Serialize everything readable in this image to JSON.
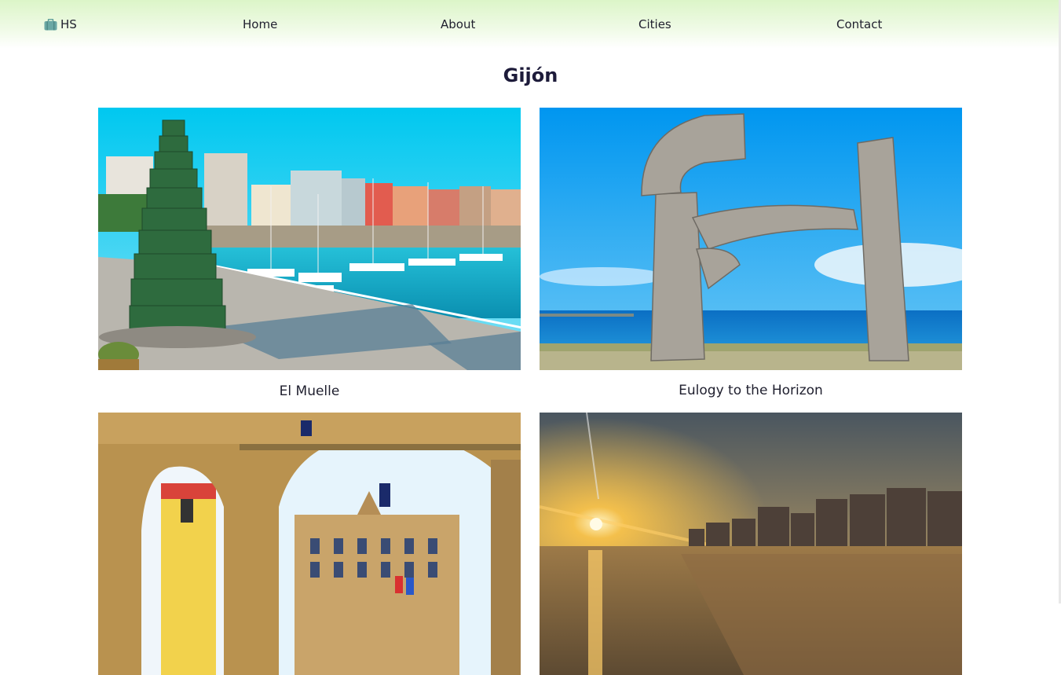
{
  "nav": {
    "brand": "HS",
    "brand_icon": "suitcase-icon",
    "links": [
      "Home",
      "About",
      "Cities",
      "Contact"
    ]
  },
  "page": {
    "title": "Gijón"
  },
  "cards": [
    {
      "caption": "El Muelle"
    },
    {
      "caption": "Eulogy to the Horizon"
    },
    {
      "caption": ""
    },
    {
      "caption": ""
    }
  ],
  "colors": {
    "nav_gradient_top": "#dcf5c8",
    "title_text": "#1d1b3a",
    "body_text": "#1f1f2e"
  }
}
